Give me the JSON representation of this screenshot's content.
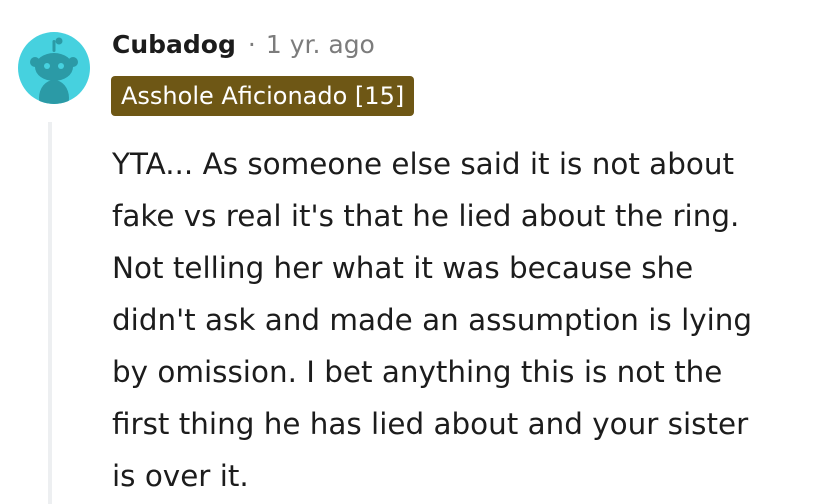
{
  "comment": {
    "author": "Cubadog",
    "separator": "·",
    "timestamp": "1 yr. ago",
    "flair": "Asshole Aficionado [15]",
    "body_lines": [
      "YTA... As someone else said it is not about",
      "fake vs real it's that he lied about the ring.",
      "Not telling her what it was because she",
      "didn't ask and made an assumption is lying",
      "by omission. I bet anything this is not the",
      "first thing he has lied about and your sister",
      "is over it."
    ]
  },
  "colors": {
    "avatar_bg": "#46d1df",
    "flair_bg": "#6e5715",
    "flair_text": "#ffffff",
    "meta_text": "#7c7c7c",
    "thread_line": "#edeff1"
  },
  "icons": {
    "avatar": "reddit-snoo-avatar-icon"
  }
}
